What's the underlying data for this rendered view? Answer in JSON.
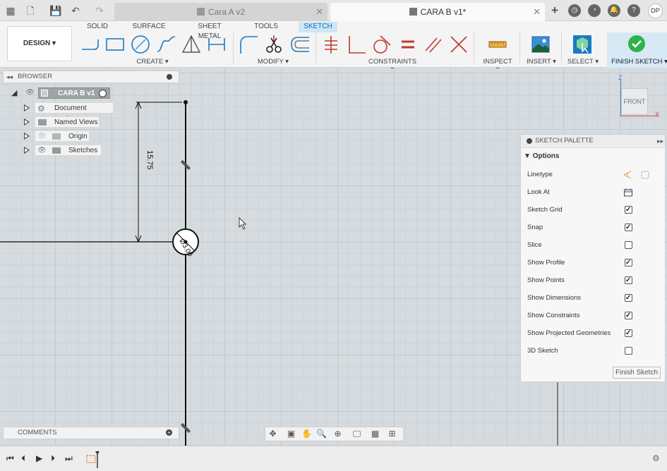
{
  "topbar": {
    "tabs": [
      {
        "label": "Cara A v2",
        "active": false
      },
      {
        "label": "CARA B v1*",
        "active": true
      }
    ],
    "avatar_initials": "DP"
  },
  "ribbon": {
    "design_label": "DESIGN",
    "tabs": [
      "SOLID",
      "SURFACE",
      "SHEET METAL",
      "TOOLS",
      "SKETCH"
    ],
    "active_tab": "SKETCH",
    "groups": [
      "CREATE",
      "MODIFY",
      "CONSTRAINTS",
      "INSPECT",
      "INSERT",
      "SELECT",
      "FINISH SKETCH"
    ],
    "accent_color": "#0a6fb3",
    "finish_color": "#2db34a"
  },
  "browser": {
    "title": "BROWSER",
    "root": "CARA B v1",
    "items": [
      "Document Settings",
      "Named Views",
      "Origin",
      "Sketches"
    ]
  },
  "viewcube": {
    "face": "FRONT",
    "axis_x": "X",
    "axis_z": "Z"
  },
  "sketch": {
    "dimension_text": "15.75",
    "diameter_text": "Ø3.00"
  },
  "palette": {
    "title": "SKETCH PALETTE",
    "section": "Options",
    "rows": [
      {
        "label": "Linetype",
        "type": "icons"
      },
      {
        "label": "Look At",
        "type": "icon"
      },
      {
        "label": "Sketch Grid",
        "checked": true
      },
      {
        "label": "Snap",
        "checked": true
      },
      {
        "label": "Slice",
        "checked": false
      },
      {
        "label": "Show Profile",
        "checked": true
      },
      {
        "label": "Show Points",
        "checked": true
      },
      {
        "label": "Show Dimensions",
        "checked": true
      },
      {
        "label": "Show Constraints",
        "checked": true
      },
      {
        "label": "Show Projected Geometries",
        "checked": true
      },
      {
        "label": "3D Sketch",
        "checked": false
      }
    ],
    "finish_button": "Finish Sketch"
  },
  "comments": {
    "title": "COMMENTS"
  }
}
